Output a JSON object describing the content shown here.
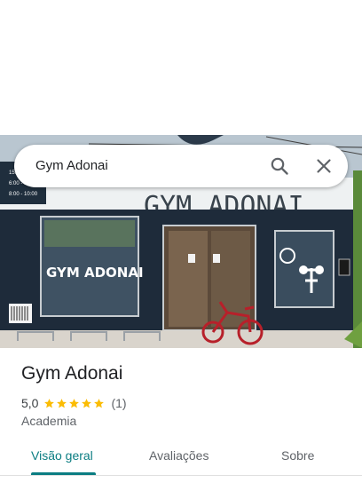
{
  "search": {
    "query": "Gym Adonai"
  },
  "photo": {
    "facade_sign": "GYM ADONAI",
    "window_sign": "GYM ADONAI",
    "schedule_text": [
      "15:00 - 21:00",
      "6:00 - 8:00",
      "8:00 - 10:00"
    ]
  },
  "place": {
    "name": "Gym Adonai",
    "rating": "5,0",
    "stars": 5,
    "review_count": "(1)",
    "category": "Academia"
  },
  "tabs": [
    {
      "label": "Visão geral",
      "active": true
    },
    {
      "label": "Avaliações",
      "active": false
    },
    {
      "label": "Sobre",
      "active": false
    }
  ],
  "colors": {
    "accent": "#0b7d82",
    "star": "#fbbc04"
  }
}
